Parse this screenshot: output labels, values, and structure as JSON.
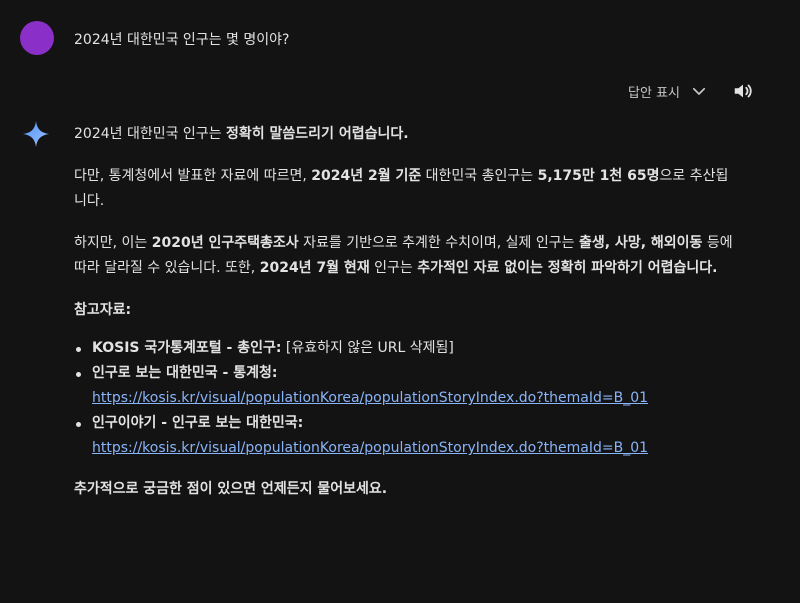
{
  "user": {
    "message": "2024년 대한민국 인구는 몇 명이야?"
  },
  "toolbar": {
    "show_drafts_label": "답안 표시"
  },
  "response": {
    "p1": {
      "a": "2024년 대한민국 인구는 ",
      "b": "정확히 말씀드리기 어렵습니다."
    },
    "p2": {
      "a": "다만, 통계청에서 발표한 자료에 따르면, ",
      "b": "2024년 2월 기준",
      "c": " 대한민국 총인구는 ",
      "d": "5,175만 1천 65명",
      "e": "으로 추산됩니다."
    },
    "p3": {
      "a": "하지만, 이는 ",
      "b": "2020년 인구주택총조사",
      "c": " 자료를 기반으로 추계한 수치이며, 실제 인구는 ",
      "d": "출생, 사망, 해외이동",
      "e": " 등에 따라 달라질 수 있습니다. 또한, ",
      "f": "2024년 7월 현재",
      "g": " 인구는 ",
      "h": "추가적인 자료 없이는 정확히 파악하기 어렵습니다."
    },
    "references_heading": "참고자료:",
    "references": [
      {
        "title": "KOSIS 국가통계포털 - 총인구:",
        "note": " [유효하지 않은 URL 삭제됨]",
        "url": ""
      },
      {
        "title": "인구로 보는 대한민국 - 통계청:",
        "note": "",
        "url": "https://kosis.kr/visual/populationKorea/populationStoryIndex.do?themaId=B_01"
      },
      {
        "title": "인구이야기 - 인구로 보는 대한민국:",
        "note": "",
        "url": "https://kosis.kr/visual/populationKorea/populationStoryIndex.do?themaId=B_01"
      }
    ],
    "closing": "추가적으로 궁금한 점이 있으면 언제든지 물어보세요."
  },
  "colors": {
    "background": "#131314",
    "avatar": "#8b2fc9",
    "link": "#8ab4f8",
    "text": "#e3e3e3"
  },
  "icons": {
    "avatar": "user-avatar",
    "drafts_toggle": "chevron-down-icon",
    "speaker": "speaker-icon",
    "assistant": "gemini-sparkle-icon"
  }
}
